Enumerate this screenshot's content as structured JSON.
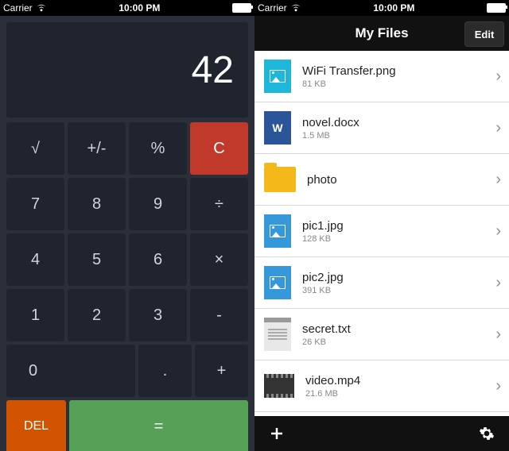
{
  "status": {
    "carrier": "Carrier",
    "time": "10:00 PM"
  },
  "calc": {
    "display": "42",
    "row1": {
      "sqrt": "√",
      "sign": "+/-",
      "pct": "%",
      "clear": "C"
    },
    "row2": {
      "n7": "7",
      "n8": "8",
      "n9": "9",
      "div": "÷"
    },
    "row3": {
      "n4": "4",
      "n5": "5",
      "n6": "6",
      "mul": "×"
    },
    "row4": {
      "n1": "1",
      "n2": "2",
      "n3": "3",
      "sub": "-"
    },
    "row5": {
      "n0": "0",
      "dot": ".",
      "add": "+"
    },
    "row6": {
      "del": "DEL",
      "eq": "="
    }
  },
  "files": {
    "title": "My Files",
    "edit": "Edit",
    "items": [
      {
        "name": " WiFi Transfer.png",
        "size": "81 KB",
        "icon": "img"
      },
      {
        "name": "novel.docx",
        "size": "1.5 MB",
        "icon": "word",
        "glyph": "W"
      },
      {
        "name": "photo",
        "size": "",
        "icon": "folder"
      },
      {
        "name": "pic1.jpg",
        "size": "128 KB",
        "icon": "jpg"
      },
      {
        "name": "pic2.jpg",
        "size": "391 KB",
        "icon": "jpg"
      },
      {
        "name": "secret.txt",
        "size": "26 KB",
        "icon": "txt"
      },
      {
        "name": "video.mp4",
        "size": "21.6 MB",
        "icon": "vid"
      }
    ]
  }
}
